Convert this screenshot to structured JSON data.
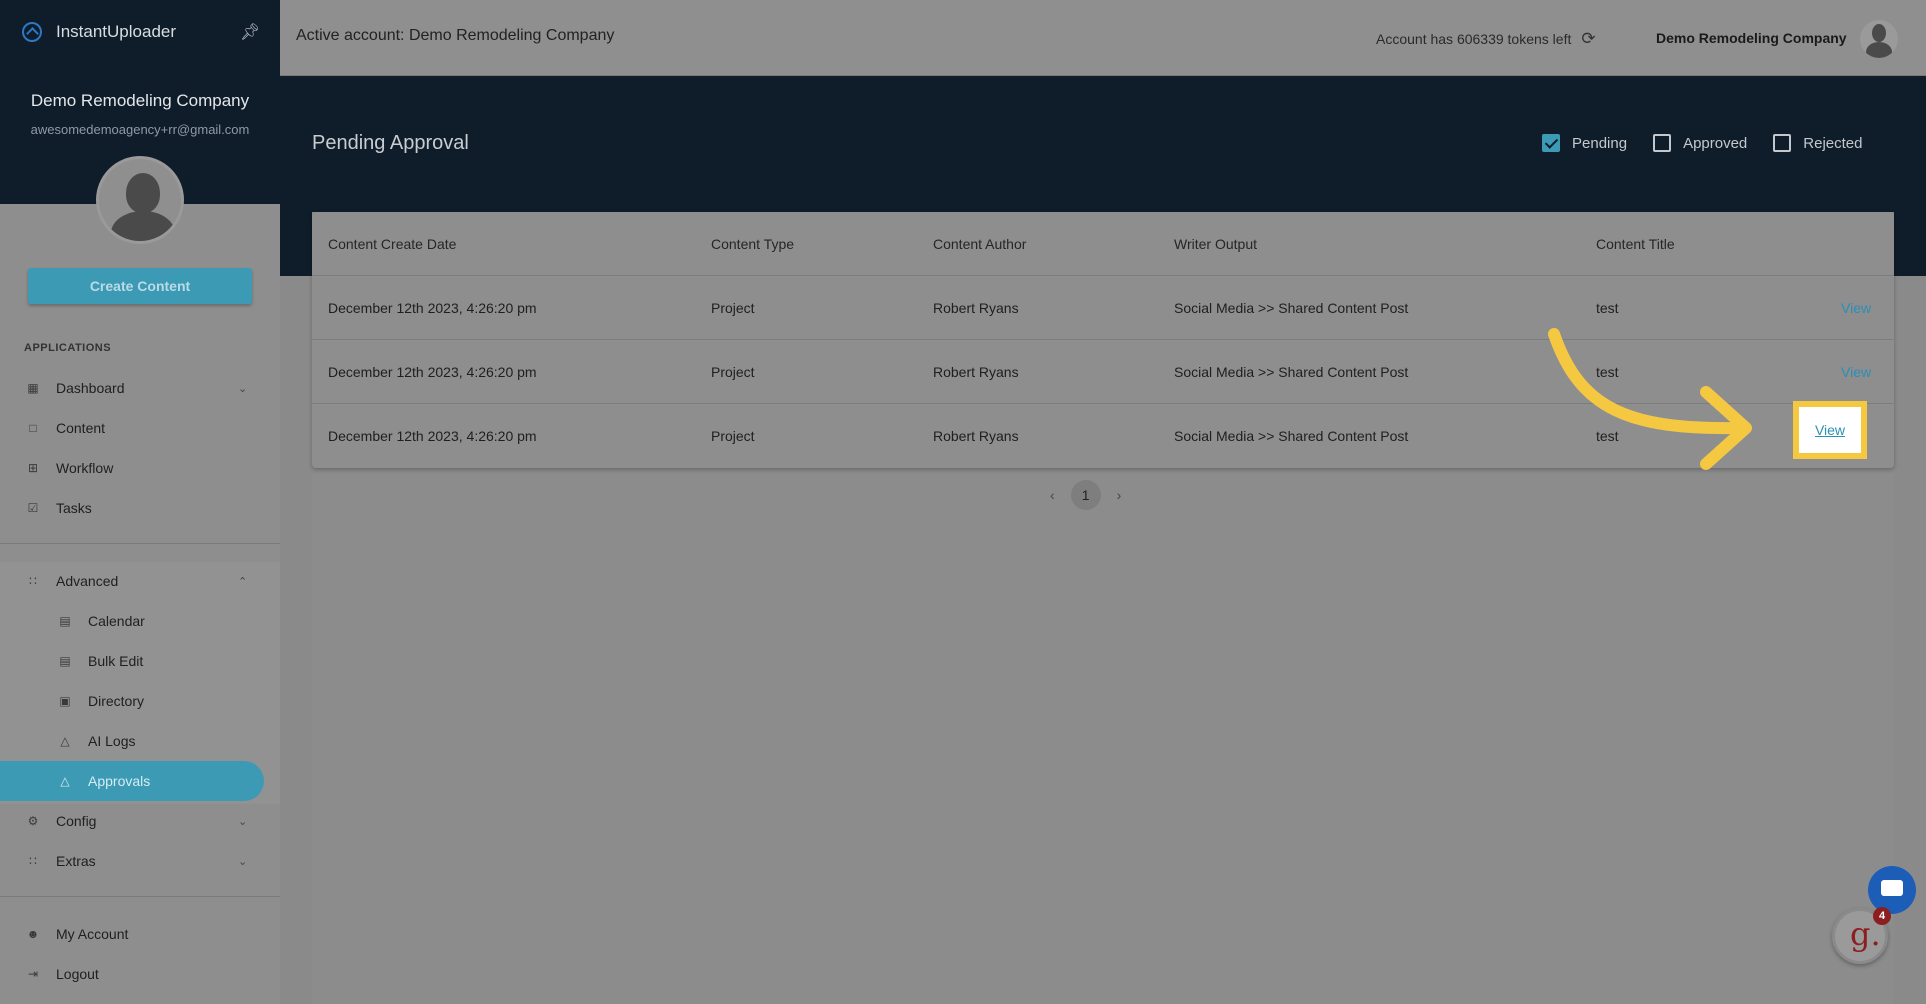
{
  "app": {
    "name": "InstantUploader",
    "logo_icon": "brand-logo-icon",
    "pin_icon": "pin-icon"
  },
  "sidebar": {
    "company": "Demo Remodeling Company",
    "email": "awesomedemoagency+rr@gmail.com",
    "create_button": "Create Content",
    "section_title": "APPLICATIONS",
    "items": [
      {
        "label": "Dashboard",
        "icon": "dashboard-icon",
        "chevron": "⌄"
      },
      {
        "label": "Content",
        "icon": "folder-icon"
      },
      {
        "label": "Workflow",
        "icon": "grid-icon"
      },
      {
        "label": "Tasks",
        "icon": "checkbox-icon"
      }
    ],
    "advanced": {
      "label": "Advanced",
      "icon": "apps-icon",
      "chevron": "⌃",
      "children": [
        {
          "label": "Calendar",
          "icon": "calendar-icon"
        },
        {
          "label": "Bulk Edit",
          "icon": "bulk-edit-icon"
        },
        {
          "label": "Directory",
          "icon": "directory-icon"
        },
        {
          "label": "AI Logs",
          "icon": "ai-logs-icon"
        },
        {
          "label": "Approvals",
          "icon": "approvals-icon"
        }
      ]
    },
    "config": {
      "label": "Config",
      "icon": "gear-icon",
      "chevron": "⌄"
    },
    "extras": {
      "label": "Extras",
      "icon": "apps-icon",
      "chevron": "⌄"
    },
    "my_account": {
      "label": "My Account",
      "icon": "user-icon"
    },
    "logout": {
      "label": "Logout",
      "icon": "logout-icon"
    }
  },
  "topbar": {
    "active_account": "Active account: Demo Remodeling Company",
    "tokens": "Account has 606339 tokens left",
    "company": "Demo Remodeling Company"
  },
  "page": {
    "title": "Pending Approval",
    "filters": [
      {
        "label": "Pending",
        "checked": true
      },
      {
        "label": "Approved",
        "checked": false
      },
      {
        "label": "Rejected",
        "checked": false
      }
    ]
  },
  "table": {
    "headers": [
      "Content Create Date",
      "Content Type",
      "Content Author",
      "Writer Output",
      "Content Title",
      ""
    ],
    "rows": [
      [
        "December 12th 2023, 4:26:20 pm",
        "Project",
        "Robert Ryans",
        "Social Media >> Shared Content Post",
        "test",
        "View"
      ],
      [
        "December 12th 2023, 4:26:20 pm",
        "Project",
        "Robert Ryans",
        "Social Media >> Shared Content Post",
        "test",
        "View"
      ],
      [
        "December 12th 2023, 4:26:20 pm",
        "Project",
        "Robert Ryans",
        "Social Media >> Shared Content Post",
        "test",
        "View"
      ]
    ]
  },
  "pagination": {
    "current": "1",
    "prev": "‹",
    "next": "›"
  },
  "widgets": {
    "g_letter": "g.",
    "badge_count": "4"
  },
  "colors": {
    "accent": "#3d9ab5",
    "dark_header": "#0f1c29",
    "highlight": "#f5c842",
    "link": "#2c8fb5"
  }
}
